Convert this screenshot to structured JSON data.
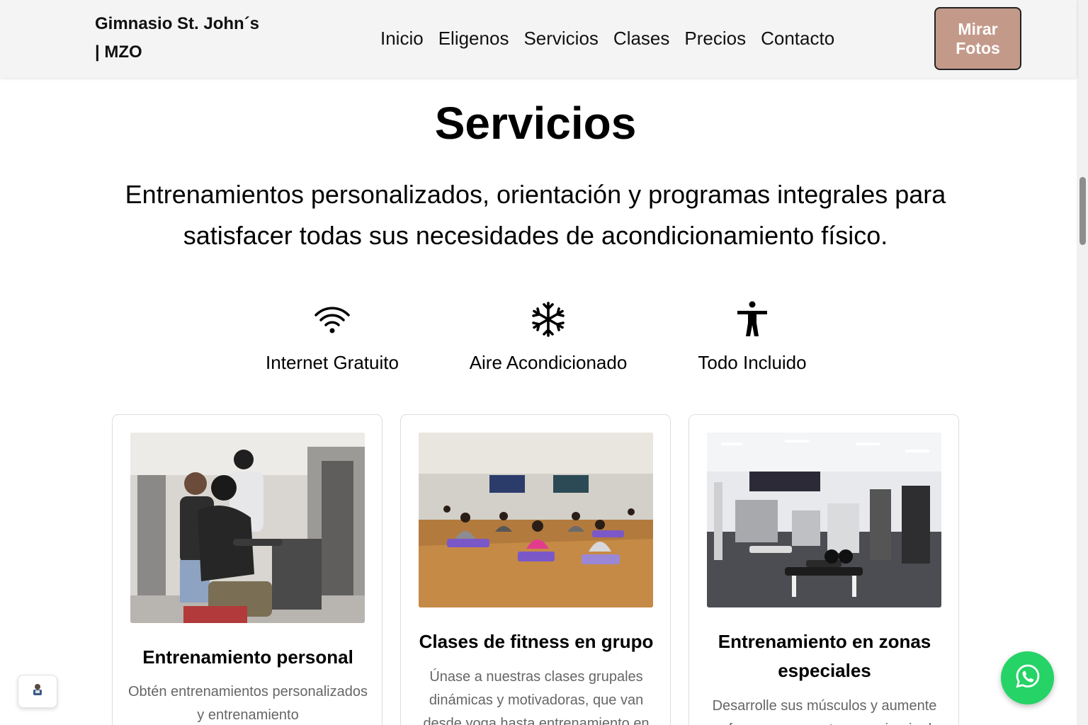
{
  "header": {
    "brand_line1": "Gimnasio St. John´s",
    "brand_line2": "| MZO",
    "nav": [
      "Inicio",
      "Eligenos",
      "Servicios",
      "Clases",
      "Precios",
      "Contacto"
    ],
    "cta_line1": "Mirar",
    "cta_line2": "Fotos",
    "cta_color": "#c39a8a"
  },
  "services": {
    "title": "Servicios",
    "subtitle": "Entrenamientos personalizados, orientación y programas integrales para satisfacer todas sus necesidades de acondicionamiento físico.",
    "features": [
      {
        "icon": "wifi-icon",
        "label": "Internet Gratuito"
      },
      {
        "icon": "snowflake-icon",
        "label": "Aire Acondicionado"
      },
      {
        "icon": "accessibility-icon",
        "label": "Todo Incluido"
      }
    ],
    "cards": [
      {
        "title": "Entrenamiento personal",
        "text": "Obtén entrenamientos personalizados y entrenamiento"
      },
      {
        "title": "Clases de fitness en grupo",
        "text": "Únase a nuestras clases grupales dinámicas y motivadoras, que van desde yoga hasta entrenamiento en"
      },
      {
        "title": "Entrenamiento en zonas especiales",
        "text": "Desarrolle sus músculos y aumente su fuerza con nuestra maquinaria de"
      }
    ]
  },
  "widgets": {
    "whatsapp_color": "#25d366"
  }
}
